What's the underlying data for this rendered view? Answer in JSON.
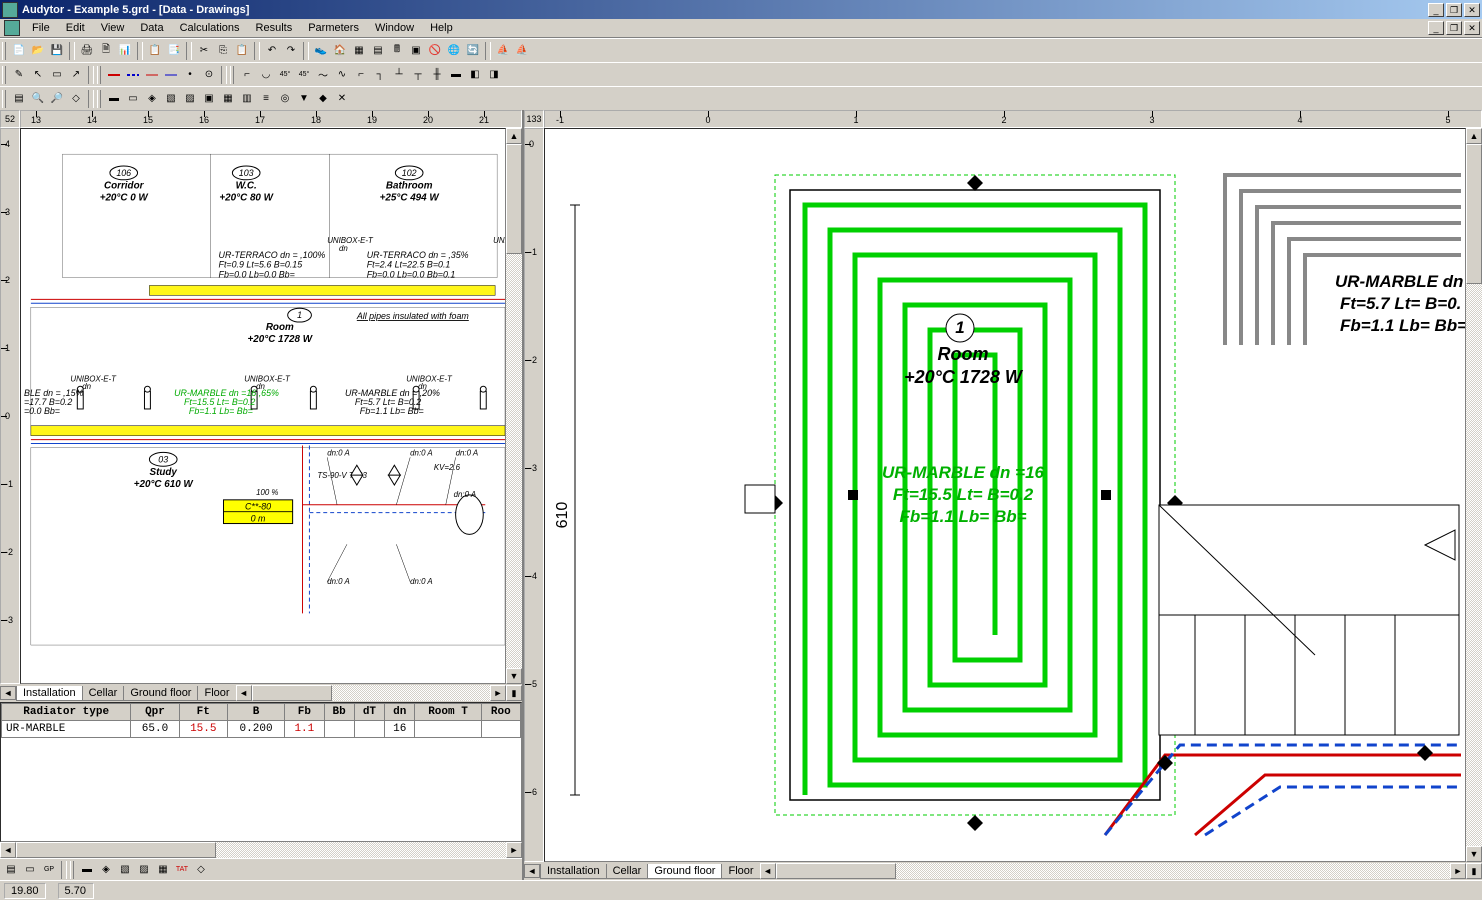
{
  "title": "Audytor - Example 5.grd - [Data - Drawings]",
  "menu": [
    "File",
    "Edit",
    "View",
    "Data",
    "Calculations",
    "Results",
    "Parmeters",
    "Window",
    "Help"
  ],
  "left": {
    "ruler_origin": "52",
    "ruler_h": [
      "13",
      "14",
      "15",
      "16",
      "17",
      "18",
      "19",
      "20",
      "21"
    ],
    "ruler_v": [
      "4",
      "3",
      "2",
      "1",
      "0",
      "-1",
      "-2",
      "-3"
    ],
    "rooms": [
      {
        "num": "106",
        "name": "Corridor",
        "info": "+20°C 0 W"
      },
      {
        "num": "103",
        "name": "W.C.",
        "info": "+20°C 80 W"
      },
      {
        "num": "102",
        "name": "Bathroom",
        "info": "+25°C 494 W"
      },
      {
        "num": "1",
        "name": "Room",
        "info": "+20°C 1728 W"
      },
      {
        "num": "03",
        "name": "Study",
        "info": "+20°C 610 W"
      }
    ],
    "annotations": {
      "ur_terraco_1": "UR-TERRACO dn =   ,100%",
      "ur_terraco_1b": "Ft=0.9 Lt=5.6 B=0.15",
      "ur_terraco_1c": "Fb=0.0 Lb=0.0 Bb=",
      "ur_terraco_2": "UR-TERRACO dn =   ,35%",
      "ur_terraco_2b": "Ft=2.4 Lt=22.5 B=0.1",
      "ur_terraco_2c": "Fb=0.0 Lb=0.0 Bb=0.1",
      "pipes_note": "All pipes insulated with foam",
      "ble_dn": "BLE dn =   ,15%",
      "ble_dn_b": "=17.7 B=0.2",
      "ble_dn_c": "=0.0 Bb=",
      "ur_marble_g": "UR-MARBLE dn =16   ,65%",
      "ur_marble_gb": "Ft=15.5 Lt= B=0.2",
      "ur_marble_gc": "Fb=1.1 Lb= Bb=",
      "ur_marble_k": "UR-MARBLE dn =   ,20%",
      "ur_marble_kb": "Ft=5.7 Lt= B=0.2",
      "ur_marble_kc": "Fb=1.1 Lb= Bb=",
      "unibox": "UNIBOX-E-T",
      "dn": "dn",
      "kv": "KV=2.6",
      "ts": "TS-90-V T723",
      "pct": "100 %",
      "yellow1": "C**-80",
      "yellow2": "0 m",
      "dn04": "dn:0 A"
    },
    "tabs": [
      "Installation",
      "Cellar",
      "Ground floor",
      "Floor"
    ],
    "active_tab": 0
  },
  "table": {
    "headers": [
      "Radiator type",
      "Qpr",
      "Ft",
      "B",
      "Fb",
      "Bb",
      "dT",
      "dn",
      "Room T",
      "Roo"
    ],
    "row": {
      "type": "UR-MARBLE",
      "Qpr": "65.0",
      "Ft": "15.5",
      "B": "0.200",
      "Fb": "1.1",
      "Bb": "",
      "dT": "",
      "dn": "16",
      "RoomT": "",
      "Roo": ""
    }
  },
  "right": {
    "ruler_origin": "133",
    "ruler_h": [
      "-1",
      "0",
      "1",
      "2",
      "3",
      "4",
      "5"
    ],
    "ruler_v": [
      "0",
      "-1",
      "-2",
      "-3",
      "-4",
      "-5",
      "-6"
    ],
    "room_num": "1",
    "room_name": "Room",
    "room_info": "+20°C 1728 W",
    "hz_green_1": "UR-MARBLE dn =16",
    "hz_green_2": "Ft=15.5 Lt= B=0.2",
    "hz_green_3": "Fb=1.1 Lb= Bb=",
    "side_1": "UR-MARBLE dn",
    "side_2": "Ft=5.7 Lt= B=0.",
    "side_3": "Fb=1.1 Lb= Bb=",
    "dim": "610",
    "tabs": [
      "Installation",
      "Cellar",
      "Ground floor",
      "Floor"
    ],
    "active_tab": 2
  },
  "status": {
    "x": "19.80",
    "y": "5.70"
  }
}
